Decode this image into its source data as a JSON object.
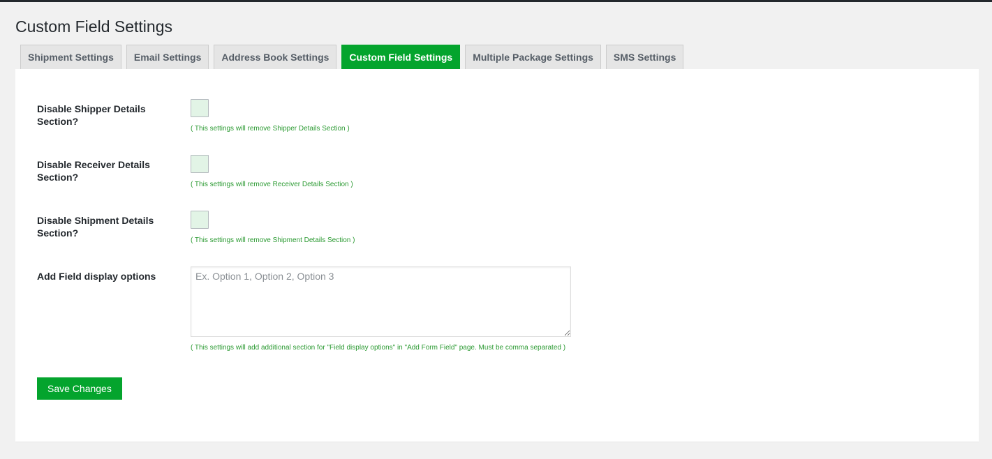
{
  "page": {
    "title": "Custom Field Settings"
  },
  "tabs": [
    {
      "label": "Shipment Settings",
      "active": false
    },
    {
      "label": "Email Settings",
      "active": false
    },
    {
      "label": "Address Book Settings",
      "active": false
    },
    {
      "label": "Custom Field Settings",
      "active": true
    },
    {
      "label": "Multiple Package Settings",
      "active": false
    },
    {
      "label": "SMS Settings",
      "active": false
    }
  ],
  "settings": {
    "shipper": {
      "label": "Disable Shipper Details Section?",
      "checked": false,
      "help": "( This settings will remove Shipper Details Section )"
    },
    "receiver": {
      "label": "Disable Receiver Details Section?",
      "checked": false,
      "help": "( This settings will remove Receiver Details Section )"
    },
    "shipment": {
      "label": "Disable Shipment Details Section?",
      "checked": false,
      "help": "( This settings will remove Shipment Details Section )"
    },
    "display_options": {
      "label": "Add Field display options",
      "value": "",
      "placeholder": "Ex. Option 1, Option 2, Option 3",
      "help": "( This settings will add additional section for \"Field display options\" in \"Add Form Field\" page. Must be comma separated )"
    }
  },
  "actions": {
    "save_label": "Save Changes"
  },
  "colors": {
    "accent": "#04a42d",
    "help_text": "#2b9a32",
    "checkbox_bg": "#e2f4e6",
    "background": "#f1f1f1"
  }
}
